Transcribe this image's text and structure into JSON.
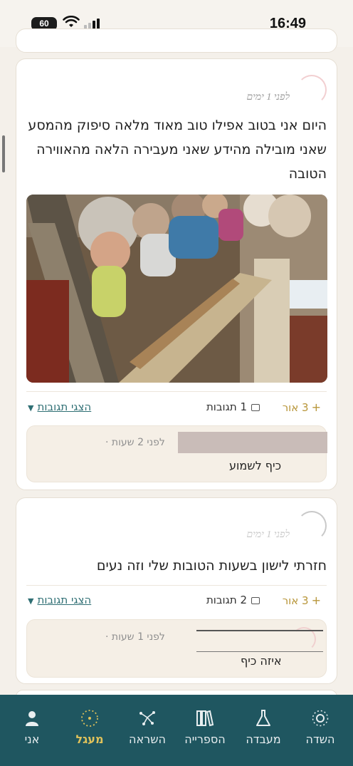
{
  "status_bar": {
    "time": "16:49",
    "battery": "60"
  },
  "posts": [
    {
      "time": "לפני 1 ימים",
      "text": "היום אני בטוב אפילו טוב מאוד מלאה סיפוק מהמסע שאני מובילה מהידע שאני מעבירה הלאה מהאווירה הטובה",
      "photo": "group-weaving-photo",
      "likes": "3 אור",
      "replies_count": "1 תגובות",
      "show_replies": "הצגי תגובות",
      "reply": {
        "time": "לפני 2 שעות",
        "text": "כיף לשמוע"
      }
    },
    {
      "time": "לפני 1 ימים",
      "text": "חזרתי לישון בשעות הטובות שלי וזה נעים",
      "likes": "3 אור",
      "replies_count": "2 תגובות",
      "show_replies": "הצגי תגובות",
      "reply": {
        "time": "לפני 1 שעות",
        "text": "איזה כיף"
      }
    }
  ],
  "nav": {
    "field": "השדה",
    "lab": "מעבדה",
    "library": "הספרייה",
    "inspiration": "השראה",
    "circle": "מעגל",
    "me": "אני"
  },
  "colors": {
    "accent": "#e0c25a",
    "nav_bg": "#1f5660",
    "link": "#2f6f74",
    "likes": "#b8963a"
  }
}
